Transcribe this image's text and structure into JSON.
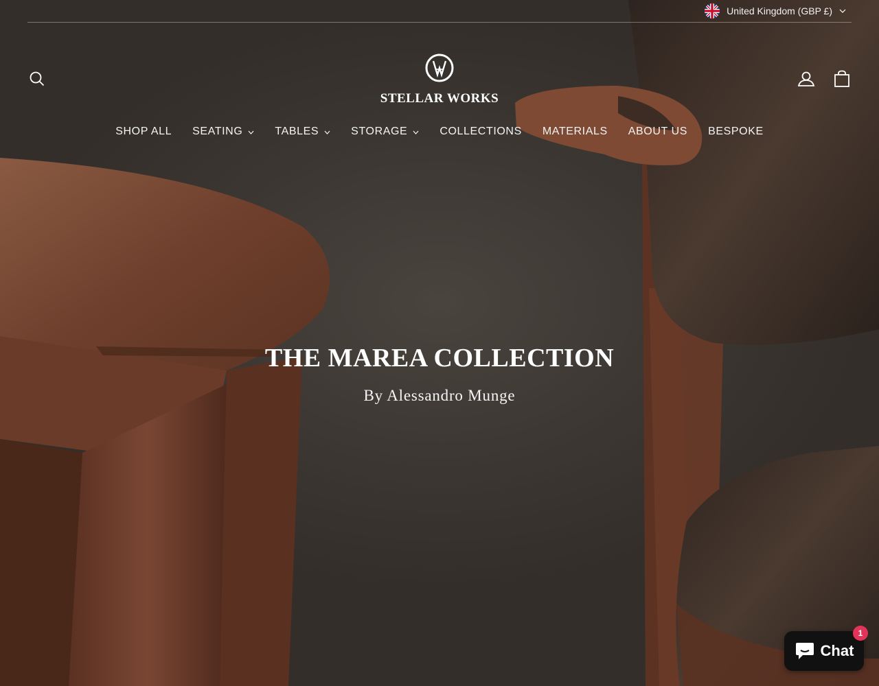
{
  "locale": {
    "label": "United Kingdom (GBP £)",
    "flag_icon": "uk-flag-icon"
  },
  "brand": {
    "name": "STELLAR WORKS"
  },
  "header": {
    "search_icon": "search-icon",
    "account_icon": "user-icon",
    "cart_icon": "shopping-bag-icon"
  },
  "nav": {
    "items": [
      {
        "label": "SHOP ALL",
        "has_dropdown": false
      },
      {
        "label": "SEATING",
        "has_dropdown": true
      },
      {
        "label": "TABLES",
        "has_dropdown": true
      },
      {
        "label": "STORAGE",
        "has_dropdown": true
      },
      {
        "label": "COLLECTIONS",
        "has_dropdown": false
      },
      {
        "label": "MATERIALS",
        "has_dropdown": false
      },
      {
        "label": "ABOUT US",
        "has_dropdown": false
      },
      {
        "label": "BESPOKE",
        "has_dropdown": false
      }
    ]
  },
  "hero": {
    "title": "THE MAREA COLLECTION",
    "subtitle": "By Alessandro Munge"
  },
  "chat": {
    "label": "Chat",
    "badge": "1",
    "icon": "chat-bubble-icon"
  },
  "colors": {
    "background": "#3a3531",
    "wood": "#7a4a34",
    "leather": "#3e2f26",
    "chat_badge": "#e0345a"
  }
}
